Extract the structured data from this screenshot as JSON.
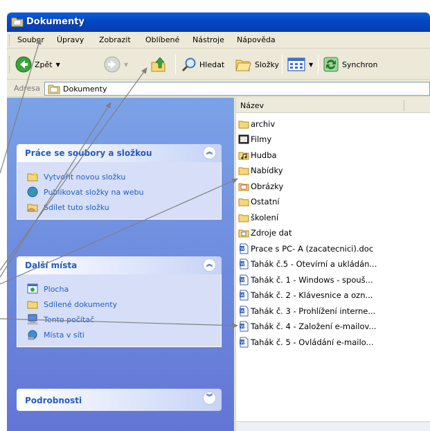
{
  "window": {
    "title": "Dokumenty"
  },
  "menubar": {
    "items": [
      "Soubor",
      "Úpravy",
      "Zobrazit",
      "Oblíbené",
      "Nástroje",
      "Nápověda"
    ]
  },
  "toolbar": {
    "back_label": "Zpět",
    "search_label": "Hledat",
    "folders_label": "Složky",
    "sync_label": "Synchron"
  },
  "address": {
    "label": "Adresa",
    "value": "Dokumenty"
  },
  "taskpane": {
    "panel1": {
      "title": "Práce se soubory a složkou",
      "items": [
        {
          "label": "Vytvořit novou složku",
          "icon": "new-folder-icon"
        },
        {
          "label": "Publikovat složky na webu",
          "icon": "publish-web-icon"
        },
        {
          "label": "Sdílet tuto složku",
          "icon": "share-folder-icon"
        }
      ]
    },
    "panel2": {
      "title": "Další místa",
      "items": [
        {
          "label": "Plocha",
          "icon": "desktop-icon"
        },
        {
          "label": "Sdílené dokumenty",
          "icon": "shared-docs-icon"
        },
        {
          "label": "Tento počítač",
          "icon": "my-computer-icon"
        },
        {
          "label": "Místa v síti",
          "icon": "network-places-icon"
        }
      ]
    },
    "panel3": {
      "title": "Podrobnosti"
    }
  },
  "files": {
    "column_name": "Název",
    "items": [
      {
        "name": "archiv",
        "icon": "folder-icon"
      },
      {
        "name": "Filmy",
        "icon": "video-folder-icon"
      },
      {
        "name": "Hudba",
        "icon": "music-folder-icon"
      },
      {
        "name": "Nabídky",
        "icon": "folder-icon"
      },
      {
        "name": "Obrázky",
        "icon": "pictures-folder-icon"
      },
      {
        "name": "Ostatní",
        "icon": "folder-icon"
      },
      {
        "name": "školení",
        "icon": "folder-icon"
      },
      {
        "name": "Zdroje dat",
        "icon": "data-sources-icon"
      },
      {
        "name": "Prace s PC-  A (zacatecnici).doc",
        "icon": "word-doc-icon"
      },
      {
        "name": "Tahák č.5 - Otevírní a ukládán...",
        "icon": "word-doc-icon"
      },
      {
        "name": "Tahák č. 1 - Windows - spouš...",
        "icon": "word-doc-icon"
      },
      {
        "name": "Tahák č. 2 - Klávesnice a ozn...",
        "icon": "word-doc-icon"
      },
      {
        "name": "Tahák č. 3 - Prohlížení interne...",
        "icon": "word-doc-icon"
      },
      {
        "name": "Tahák č. 4 - Založení e-mailov...",
        "icon": "word-doc-icon"
      },
      {
        "name": "Tahák č. 5 - Ovládání  e-mailo...",
        "icon": "word-doc-icon"
      }
    ]
  },
  "colors": {
    "xp_blue": "#0548c4",
    "task_link": "#215dc6",
    "pane_bg": "#7ba2e7"
  }
}
